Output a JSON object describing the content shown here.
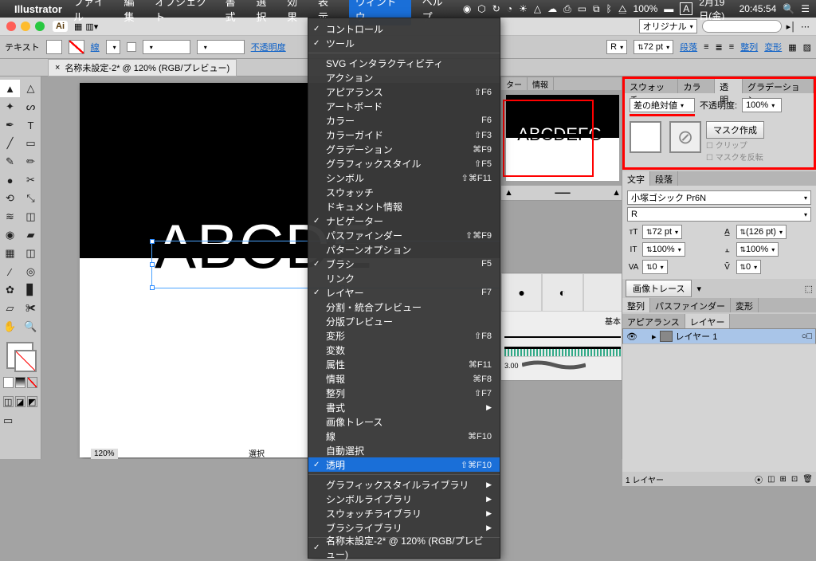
{
  "menubar": {
    "app": "Illustrator",
    "items": [
      "ファイル",
      "編集",
      "オブジェクト",
      "書式",
      "選択",
      "効果",
      "表示",
      "ウィンドウ",
      "ヘルプ"
    ],
    "active_index": 7,
    "battery": "100%",
    "input_label": "A",
    "date": "2月19日(金)",
    "time": "20:45:54"
  },
  "titlebar": {
    "logo": "Ai",
    "preset_label": "オリジナル",
    "search_placeholder": ""
  },
  "ctrlbar": {
    "label": "テキスト",
    "stroke_label": "線",
    "opacity_label": "不透明度",
    "font_value": "R",
    "size_value": "72 pt",
    "para_label": "段落",
    "align_label": "整列",
    "transform_label": "変形"
  },
  "doc_tab": {
    "title": "名称未設定-2* @ 120% (RGB/プレビュー)",
    "close": "×"
  },
  "dropdown": {
    "top": [
      {
        "label": "コントロール",
        "check": true
      },
      {
        "label": "ツール",
        "check": true
      }
    ],
    "main": [
      {
        "label": "SVG インタラクティビティ"
      },
      {
        "label": "アクション"
      },
      {
        "label": "アピアランス",
        "sc": "⇧F6"
      },
      {
        "label": "アートボード"
      },
      {
        "label": "カラー",
        "sc": "F6"
      },
      {
        "label": "カラーガイド",
        "sc": "⇧F3"
      },
      {
        "label": "グラデーション",
        "sc": "⌘F9"
      },
      {
        "label": "グラフィックスタイル",
        "sc": "⇧F5"
      },
      {
        "label": "シンボル",
        "sc": "⇧⌘F11"
      },
      {
        "label": "スウォッチ"
      },
      {
        "label": "ドキュメント情報"
      },
      {
        "label": "ナビゲーター",
        "check": true
      },
      {
        "label": "パスファインダー",
        "sc": "⇧⌘F9"
      },
      {
        "label": "パターンオプション"
      },
      {
        "label": "ブラシ",
        "check": true,
        "sc": "F5"
      },
      {
        "label": "リンク"
      },
      {
        "label": "レイヤー",
        "check": true,
        "sc": "F7"
      },
      {
        "label": "分割・統合プレビュー"
      },
      {
        "label": "分版プレビュー"
      },
      {
        "label": "変形",
        "sc": "⇧F8"
      },
      {
        "label": "変数"
      },
      {
        "label": "属性",
        "sc": "⌘F11"
      },
      {
        "label": "情報",
        "sc": "⌘F8"
      },
      {
        "label": "整列",
        "sc": "⇧F7"
      },
      {
        "label": "書式",
        "arrow": true
      },
      {
        "label": "画像トレース"
      },
      {
        "label": "線",
        "sc": "⌘F10"
      },
      {
        "label": "自動選択"
      },
      {
        "label": "透明",
        "check": true,
        "sc": "⇧⌘F10",
        "hilite": true
      }
    ],
    "libs": [
      {
        "label": "グラフィックスタイルライブラリ",
        "arrow": true
      },
      {
        "label": "シンボルライブラリ",
        "arrow": true
      },
      {
        "label": "スウォッチライブラリ",
        "arrow": true
      },
      {
        "label": "ブラシライブラリ",
        "arrow": true
      }
    ],
    "windows": [
      {
        "label": "名称未設定-2* @ 120% (RGB/プレビュー)",
        "check": true
      }
    ]
  },
  "canvas": {
    "text": "ABCDE",
    "nav_text": "ABCDEFG",
    "zoom": "120%",
    "status": "選択"
  },
  "panels": {
    "transparency": {
      "tabs": [
        "スウォッチ",
        "カラー",
        "透明",
        "グラデーション"
      ],
      "active_tab": 2,
      "blend_mode": "差の絶対値",
      "opacity_label": "不透明度:",
      "opacity_value": "100%",
      "make_mask": "マスク作成",
      "clip": "クリップ",
      "invert": "マスクを反転"
    },
    "character": {
      "tabs": [
        "文字",
        "段落"
      ],
      "font_family": "小塚ゴシック Pr6N",
      "font_style": "R",
      "size": "72 pt",
      "leading": "(126 pt)",
      "vscale": "100%",
      "hscale": "100%",
      "tracking_a": "0",
      "tracking_b": "0"
    },
    "trace_label": "画像トレース",
    "align_tabs": [
      "整列",
      "パスファインダー",
      "変形"
    ],
    "layer_tabs": [
      "アピアランス",
      "レイヤー"
    ],
    "layer_name": "レイヤー 1",
    "layer_active_tab": 1,
    "layer_count": "1 レイヤー"
  },
  "mini": {
    "nav_tabs": [
      "ター",
      "情報"
    ],
    "brush_val": "3.00",
    "brush_label": "基本"
  }
}
